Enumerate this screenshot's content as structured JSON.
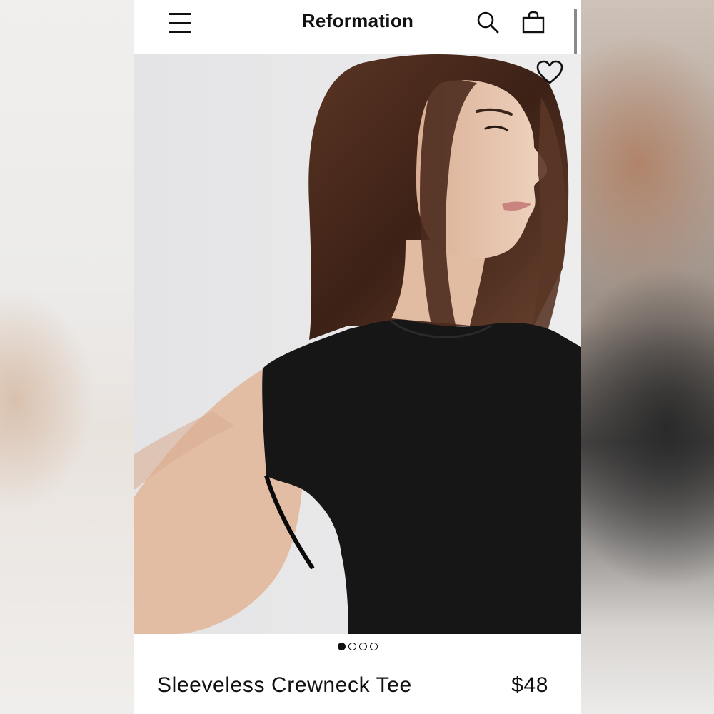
{
  "header": {
    "brand": "Reformation",
    "icons": {
      "menu": "hamburger-menu-icon",
      "search": "search-icon",
      "bag": "shopping-bag-icon",
      "wishlist": "heart-icon"
    }
  },
  "gallery": {
    "image_description_icon": "product-photo",
    "total_images": 4,
    "active_index": 0
  },
  "product": {
    "name": "Sleeveless Crewneck Tee",
    "price": "$48"
  },
  "colors": {
    "text": "#111111",
    "background": "#ffffff",
    "garment": "#161616",
    "hair": "#4a2a1c",
    "skin": "#e6c3ac"
  }
}
